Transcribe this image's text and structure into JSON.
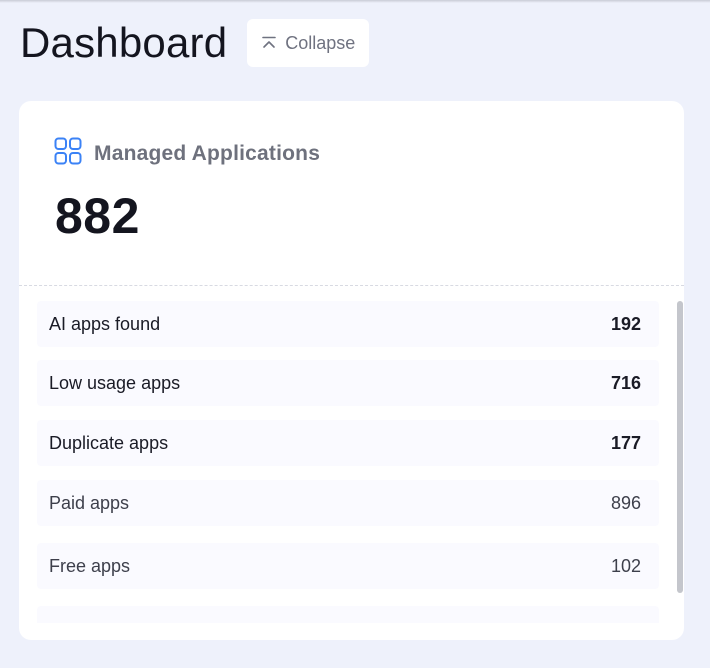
{
  "page": {
    "title": "Dashboard",
    "collapse_label": "Collapse"
  },
  "card": {
    "title": "Managed Applications",
    "icon": "grid-icon",
    "accent_color": "#3b82f6",
    "total": "882"
  },
  "rows": [
    {
      "label": "AI apps found",
      "value": "192"
    },
    {
      "label": "Low usage apps",
      "value": "716"
    },
    {
      "label": "Duplicate apps",
      "value": "177"
    },
    {
      "label": "Paid apps",
      "value": "896"
    },
    {
      "label": "Free apps",
      "value": "102"
    }
  ]
}
